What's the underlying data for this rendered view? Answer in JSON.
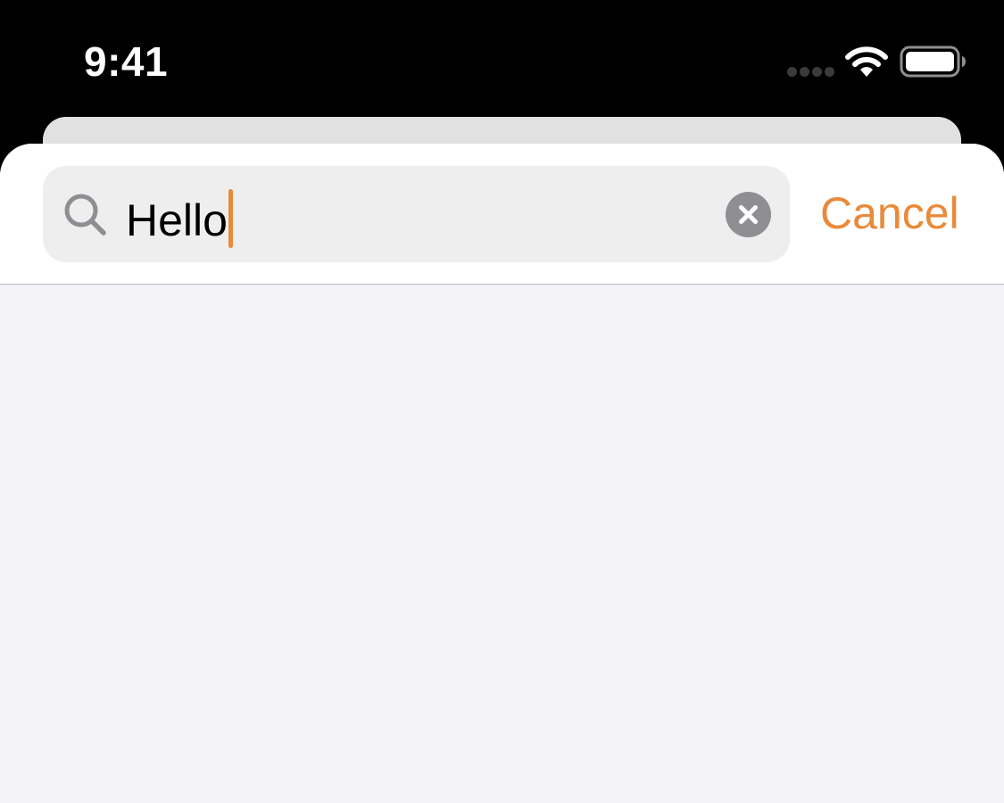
{
  "status_bar": {
    "time": "9:41",
    "signal_icon": "cellular-signal-icon",
    "wifi_icon": "wifi-icon",
    "battery_icon": "battery-icon"
  },
  "search": {
    "value": "Hello",
    "search_icon": "search-icon",
    "clear_icon": "clear-icon",
    "cancel_label": "Cancel"
  },
  "colors": {
    "accent": "#E98A3A",
    "status_bar_background": "#000000",
    "header_background": "#FFFFFF",
    "search_field_background": "#EEEEEF",
    "content_background": "#F2F2F7",
    "clear_button": "#8E8E93"
  }
}
